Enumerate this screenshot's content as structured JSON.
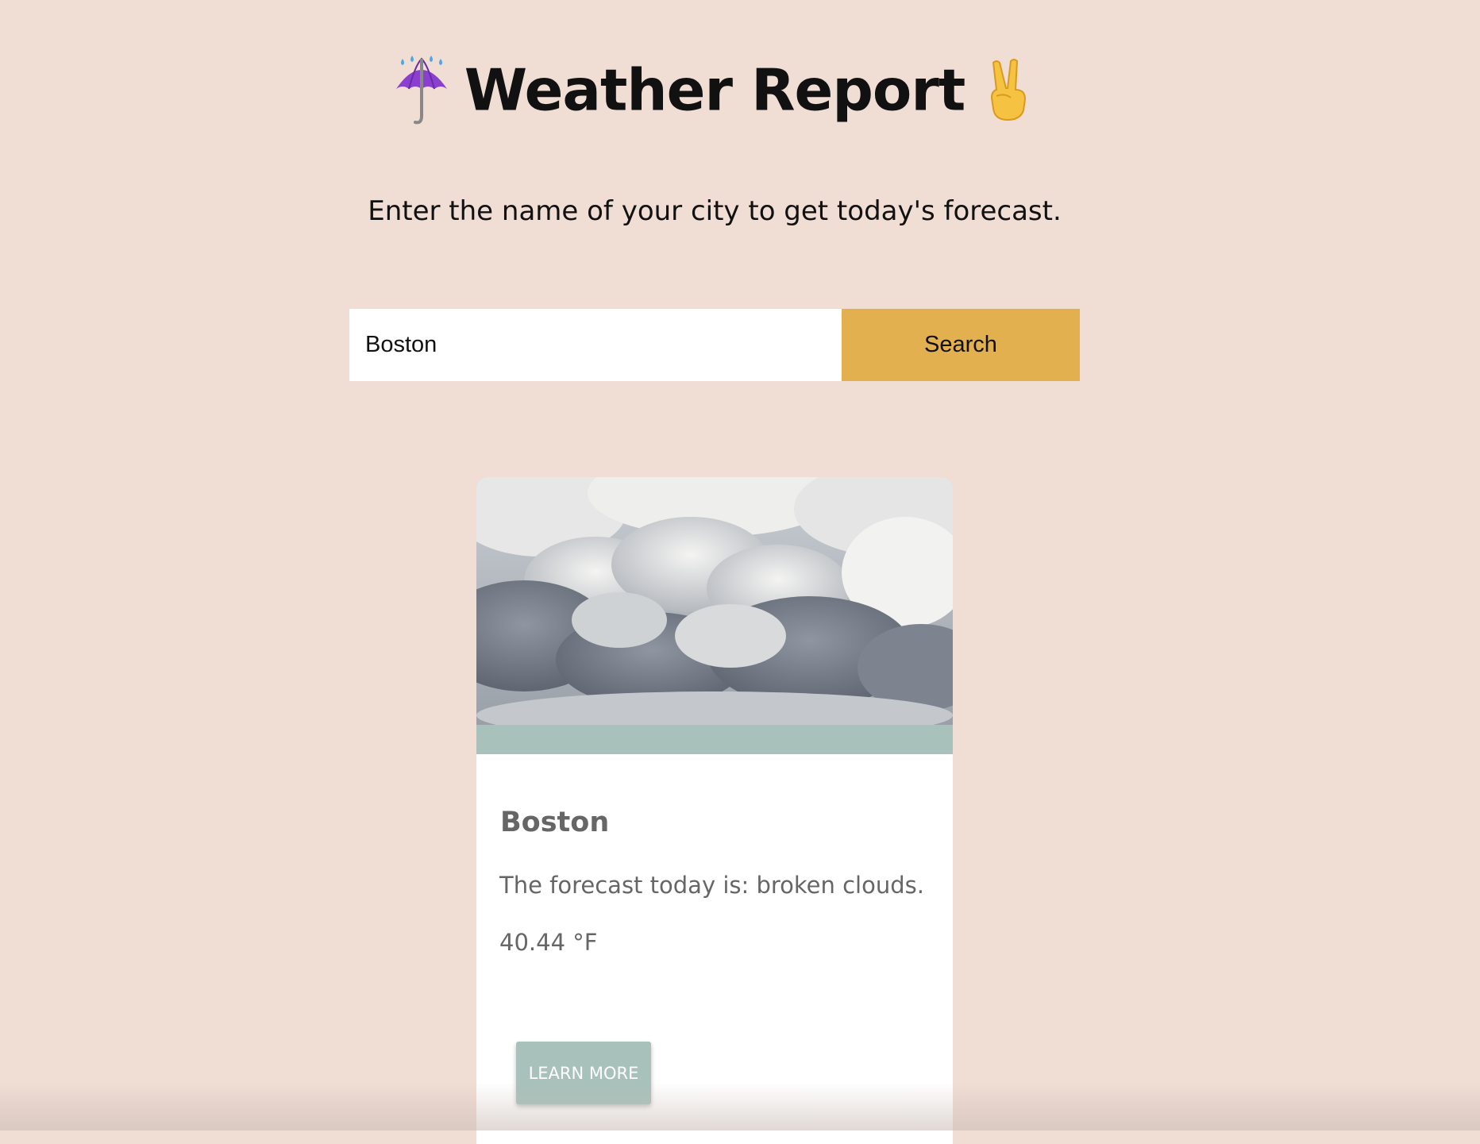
{
  "header": {
    "title": "Weather Report",
    "left_icon": "umbrella-rain-icon",
    "right_icon": "victory-hand-icon"
  },
  "intro": {
    "text": "Enter the name of your city to get today's forecast."
  },
  "search": {
    "value": "Boston",
    "button_label": "Search"
  },
  "card": {
    "image_icon": "clouds-photo",
    "city": "Boston",
    "forecast": "The forecast today is: broken clouds.",
    "temperature": "40.44 °F",
    "button_label": "LEARN MORE"
  },
  "colors": {
    "background": "#f0ddd4",
    "search_button": "#e2b04e",
    "accent": "#a8c1bb",
    "card_text": "#666666"
  }
}
